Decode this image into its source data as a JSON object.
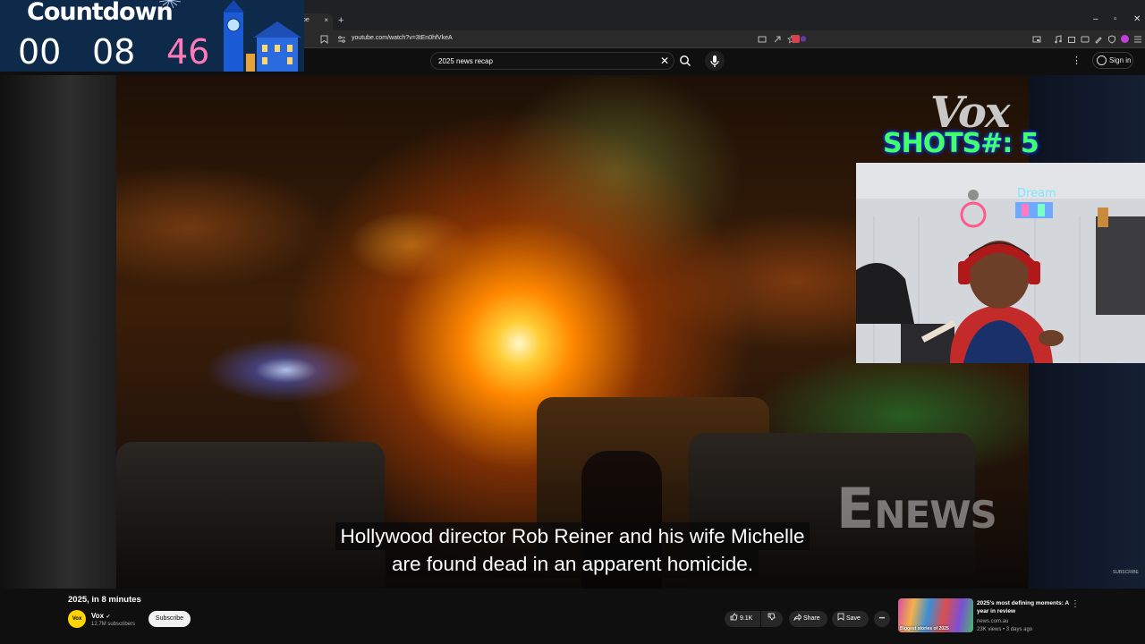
{
  "browser": {
    "tab_label": "be",
    "tab_close": "×",
    "new_tab": "+",
    "url": "youtube.com/watch?v=3tEn0hfVkeA",
    "win_minimize": "–",
    "win_restore": "▫",
    "win_close": "✕"
  },
  "youtube": {
    "search_value": "2025 news recap",
    "clear_glyph": "✕",
    "signin_label": "Sign in",
    "menu_glyph": "⋮"
  },
  "countdown": {
    "title": "Countdown",
    "hours": "00",
    "minutes": "08",
    "seconds": "46",
    "seconds_color": "#ff7ab8"
  },
  "overlay": {
    "vox_logo": "Vox",
    "shots_label": "SHOTS#: 5",
    "shots_color": "#43ff6a"
  },
  "video": {
    "watermark_e": "E",
    "watermark_news": "NEWS",
    "caption_line1": "Hollywood director Rob Reiner and his wife Michelle",
    "caption_line2": "are found dead in an apparent homicide.",
    "subscribe_watermark": "SUBSCRIBE"
  },
  "info": {
    "title": "2025, in 8 minutes",
    "channel_avatar": "Vox",
    "channel_name": "Vox",
    "channel_verified": "✔",
    "subscribers": "12.7M subscribers",
    "subscribe_label": "Subscribe",
    "like_count": "9.1K",
    "share_label": "Share",
    "save_label": "Save",
    "more_glyph": "•••"
  },
  "recommendation": {
    "title": "2025's most defining moments: A year in review",
    "channel": "news.com.au",
    "meta": "23K views • 3 days ago",
    "thumb_text": "Biggest stories of 2025",
    "menu_glyph": "⋮"
  }
}
